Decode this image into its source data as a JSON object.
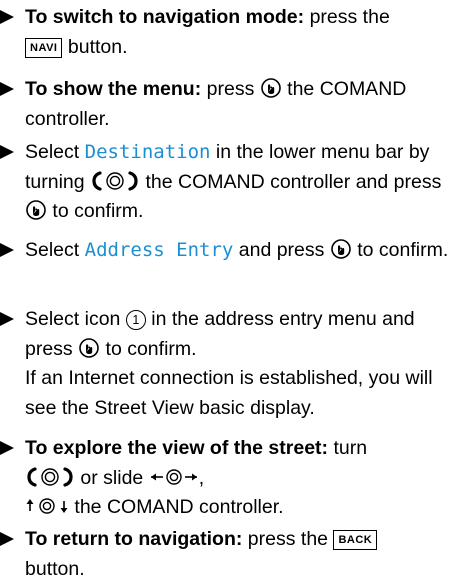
{
  "steps": [
    {
      "lead": "To switch to navigation mode:",
      "t1": " press the",
      "key": "NAVI",
      "t2": " button."
    },
    {
      "lead": "To show the menu:",
      "t1": " press",
      "t2": " the COMAND controller."
    },
    {
      "t1": "Select ",
      "ui": "Destination",
      "t2": " in the lower menu bar by turning ",
      "t3": " the COMAND controller and press ",
      "t4": " to confirm."
    },
    {
      "t1": "Select ",
      "ui": "Address Entry",
      "t2": " and press ",
      "t3": " to confirm."
    },
    {
      "t1": "Select icon ",
      "num": "1",
      "t2": " in the address entry menu and press ",
      "t3": " to confirm.",
      "note": "If an Internet connection is established, you will see the Street View basic display."
    },
    {
      "lead": "To explore the view of the street:",
      "t1": " turn",
      "t2": " or slide ",
      "t3": ",",
      "t4": " the COMAND controller."
    },
    {
      "lead": "To return to navigation:",
      "t1": " press the",
      "key": "BACK",
      "t2": " button."
    }
  ],
  "icons": {
    "press": "press-controller-icon",
    "turn": "turn-controller-icon",
    "slide_lr": "slide-left-right-icon",
    "slide_ud": "slide-up-down-icon"
  }
}
